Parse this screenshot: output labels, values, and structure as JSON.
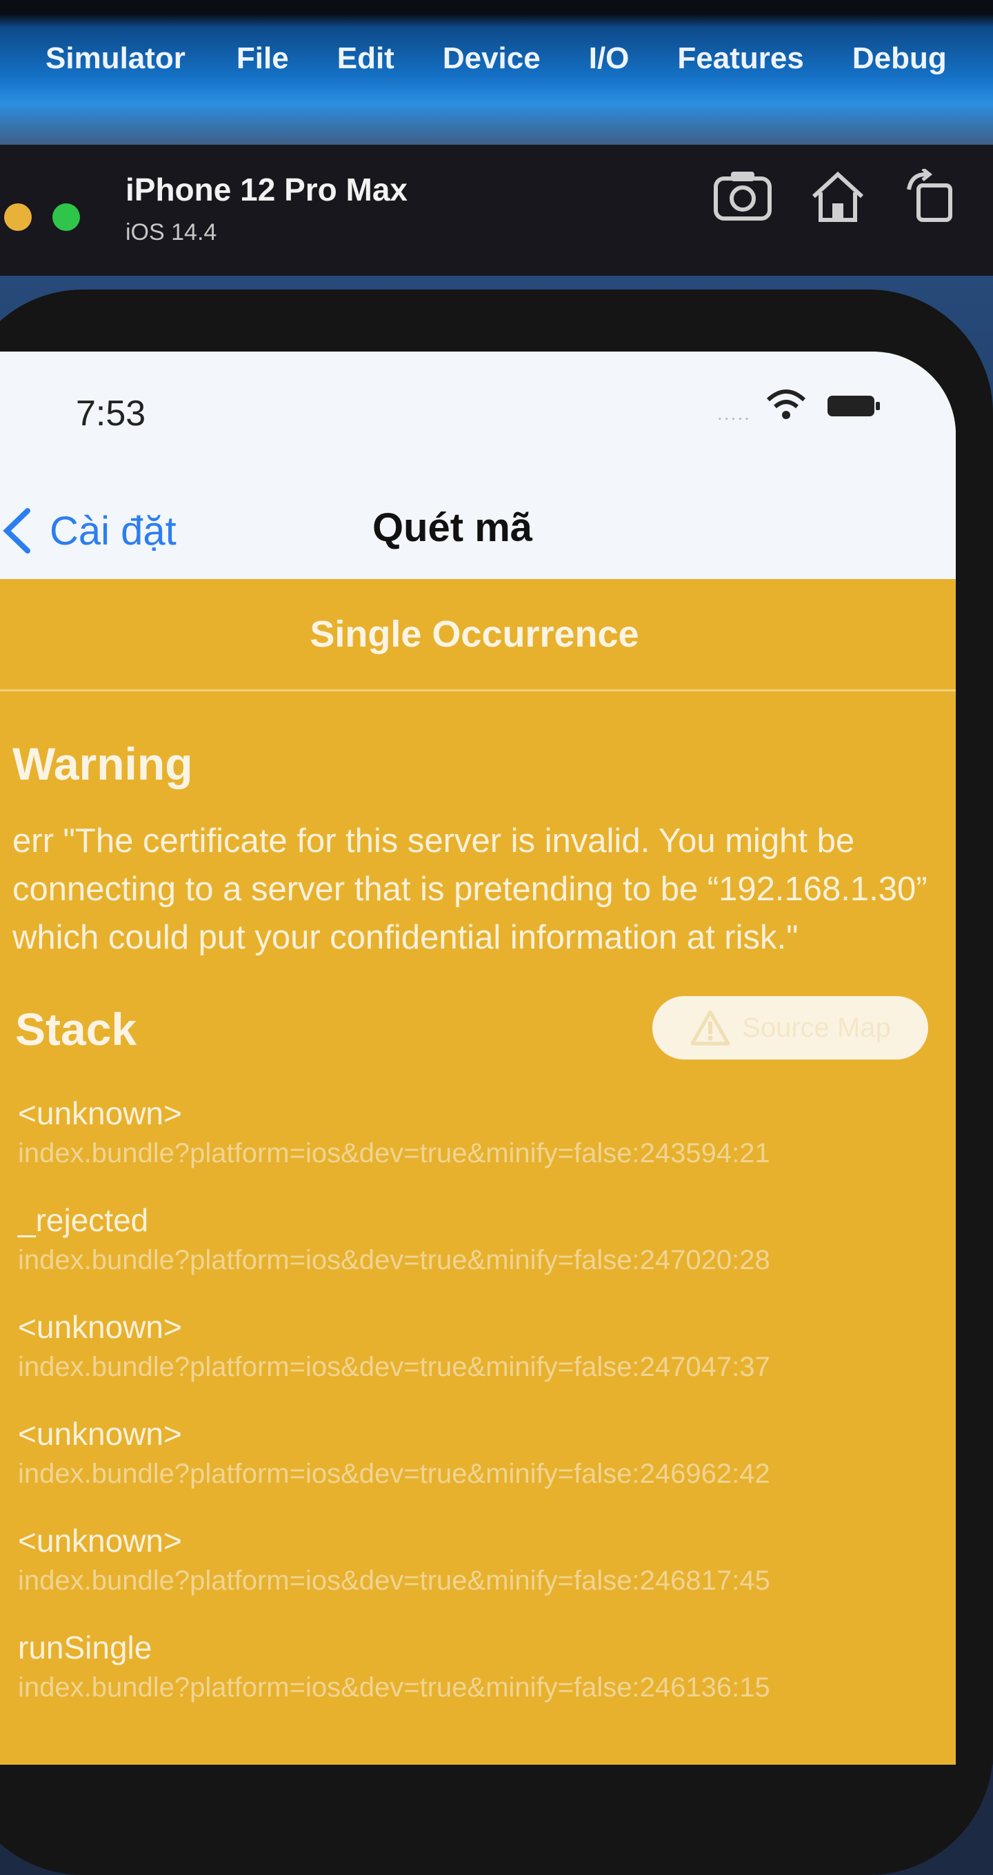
{
  "menubar": {
    "items": [
      "Simulator",
      "File",
      "Edit",
      "Device",
      "I/O",
      "Features",
      "Debug"
    ]
  },
  "window": {
    "device_name": "iPhone 12 Pro Max",
    "os_version": "iOS 14.4"
  },
  "status_bar": {
    "time": "7:53",
    "signal_dots": "....."
  },
  "nav": {
    "back_label": "Cài đặt",
    "title": "Quét mã"
  },
  "error_overlay": {
    "header": "Single Occurrence",
    "warning_title": "Warning",
    "message": "err  \"The certificate for this server is invalid. You might be connecting to a server that is pretending to be “192.168.1.30” which could put your confidential information at risk.\"",
    "stack_title": "Stack",
    "source_map_label": "Source Map",
    "frames": [
      {
        "name": "<unknown>",
        "location": "index.bundle?platform=ios&dev=true&minify=false:243594:21"
      },
      {
        "name": "_rejected",
        "location": "index.bundle?platform=ios&dev=true&minify=false:247020:28"
      },
      {
        "name": "<unknown>",
        "location": "index.bundle?platform=ios&dev=true&minify=false:247047:37"
      },
      {
        "name": "<unknown>",
        "location": "index.bundle?platform=ios&dev=true&minify=false:246962:42"
      },
      {
        "name": "<unknown>",
        "location": "index.bundle?platform=ios&dev=true&minify=false:246817:45"
      },
      {
        "name": "runSingle",
        "location": "index.bundle?platform=ios&dev=true&minify=false:246136:15"
      }
    ]
  },
  "colors": {
    "overlay_bg": "#e7b12e",
    "ios_blue": "#2c7ef0"
  }
}
